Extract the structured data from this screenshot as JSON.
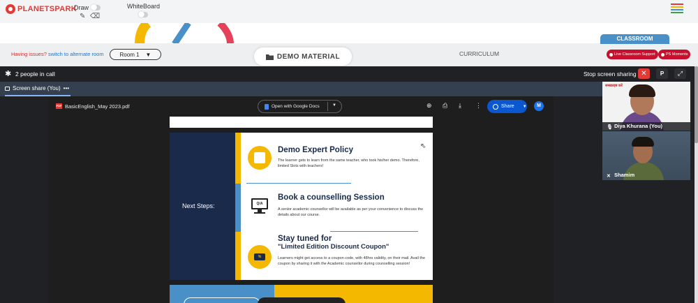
{
  "header": {
    "brand": "PLANETSPARK",
    "draw_label": "Draw",
    "whiteboard_label": "WhiteBoard"
  },
  "nav": {
    "issues_text": "Having issues?",
    "alternate_link": "switch to alternate room",
    "room_selected": "Room 1",
    "demo_material": "DEMO MATERIAL",
    "curriculum": "CURRICULUM",
    "classroom": "CLASSROOM",
    "live_support": "Live Classroom Support",
    "ps_moments": "PS Moments"
  },
  "call": {
    "people_count": "2 people in call",
    "stop_sharing": "Stop screen sharing",
    "close_glyph": "✕",
    "p_button": "P",
    "expand_glyph": "⤢",
    "share_tab": "Screen share (You)",
    "share_more": "•••"
  },
  "viewer": {
    "file_name": "BasicEnglish_May 2023.pdf",
    "pdf_badge": "PDF",
    "open_with": "Open with Google Docs",
    "share": "Share",
    "avatar_initial": "M"
  },
  "slide": {
    "next_steps": "Next Steps:",
    "monitor_text": "Q/A",
    "coupon_badge": "%",
    "items": [
      {
        "title": "Demo Expert Policy",
        "body": "The learner gets to learn from the same teacher, who took his/her demo. Therefore, limited Slots with teachers!"
      },
      {
        "title": "Book a counselling Session",
        "body": "A senior academic counsellor will be available as per your convenience to discuss the details about our course."
      },
      {
        "title": "Stay tuned for",
        "subtitle": "\"Limited Edition Discount Coupon\"",
        "body": "Learners might get access to a coupon code, with 48hrs validity, on their mail. Avail the coupon by sharing it with the Academic counsellor during counselling session!"
      }
    ]
  },
  "participants": [
    {
      "name": "Diya Khurana (You)",
      "sign_text": "सब्स्क्राइब करें"
    },
    {
      "name": "Shamim"
    }
  ],
  "colors": {
    "brand_red": "#e53935",
    "classroom_blue": "#4a90c8",
    "pill_red": "#c8102e",
    "slide_navy": "#1a2a4a",
    "slide_yellow": "#f5b800",
    "share_blue": "#0b57d0"
  }
}
